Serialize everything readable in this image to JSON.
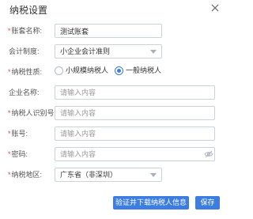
{
  "dialog": {
    "title": "纳税设置"
  },
  "form": {
    "account_name": {
      "required": "*",
      "label": "账套名称:",
      "value": "测试账套"
    },
    "accounting_system": {
      "required": "",
      "label": "会计制度:",
      "selected": "小企业会计准则"
    },
    "taxpayer_type": {
      "required": "*",
      "label": "纳税性质:",
      "options": [
        "小规模纳税人",
        "一般纳税人"
      ],
      "selected": "一般纳税人"
    },
    "company_name": {
      "required": "",
      "label": "企业名称:",
      "placeholder": "请输入内容"
    },
    "taxpayer_id": {
      "required": "*",
      "label": "纳税人识别号:",
      "placeholder": "请输入内容"
    },
    "account_no": {
      "required": "*",
      "label": "账号:",
      "placeholder": "请输入内容"
    },
    "password": {
      "required": "*",
      "label": "密码:",
      "placeholder": "请输入内容"
    },
    "tax_region": {
      "required": "*",
      "label": "纳税地区:",
      "selected": "广东省（非深圳）"
    }
  },
  "buttons": {
    "verify_label": "验证并下载纳税人信息",
    "save_label": "保存"
  },
  "colors": {
    "primary": "#3b7de0",
    "required": "#e04444",
    "border": "#cdd3db"
  }
}
